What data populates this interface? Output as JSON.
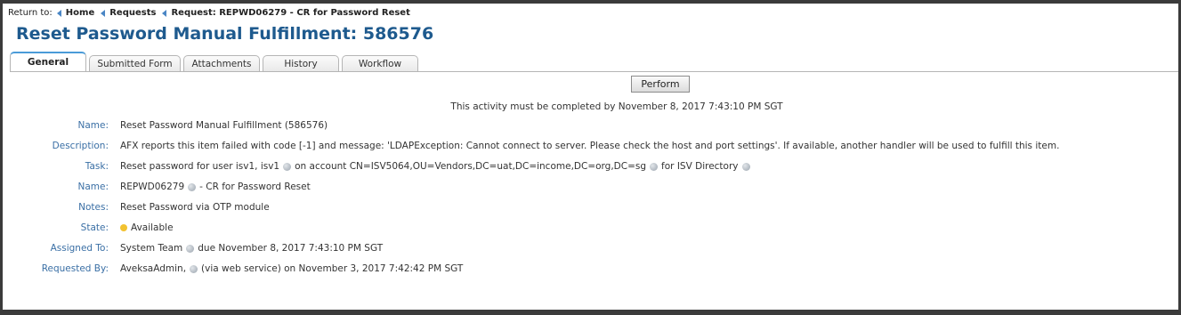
{
  "breadcrumb": {
    "prefix": "Return to:",
    "items": [
      "Home",
      "Requests",
      "Request: REPWD06279 - CR for Password Reset"
    ]
  },
  "page_title": "Reset Password Manual Fulfillment: 586576",
  "tabs": [
    "General",
    "Submitted Form",
    "Attachments",
    "History",
    "Workflow"
  ],
  "active_tab": "General",
  "perform_label": "Perform",
  "completion_notice": "This activity must be completed by November 8, 2017 7:43:10 PM SGT",
  "details": {
    "name": {
      "label": "Name:",
      "value": "Reset Password Manual Fulfillment (586576)"
    },
    "description": {
      "label": "Description:",
      "value": "AFX reports this item failed with code [-1] and message: 'LDAPException: Cannot connect to server. Please check the host and port settings'. If available, another handler will be used to fulfill this item."
    },
    "task": {
      "label": "Task:",
      "part1": "Reset password for user isv1, isv1",
      "part2": "on account CN=ISV5064,OU=Vendors,DC=uat,DC=income,DC=org,DC=sg",
      "part3": "for ISV Directory"
    },
    "request_name": {
      "label": "Name:",
      "id": "REPWD06279",
      "suffix": "- CR for Password Reset"
    },
    "notes": {
      "label": "Notes:",
      "value": "Reset Password via OTP module"
    },
    "state": {
      "label": "State:",
      "value": "Available",
      "color": "#f2c230"
    },
    "assigned_to": {
      "label": "Assigned To:",
      "assignee": "System Team",
      "due": "due November 8, 2017 7:43:10 PM SGT"
    },
    "requested_by": {
      "label": "Requested By:",
      "requester": "AveksaAdmin,",
      "via": "(via web service) on November 3, 2017 7:42:42 PM SGT"
    }
  },
  "colors": {
    "title": "#1e5a8e",
    "label": "#3a6fa5",
    "breadcrumb_arrow": "#4a86c5",
    "active_tab_accent": "#4a9bd8"
  }
}
